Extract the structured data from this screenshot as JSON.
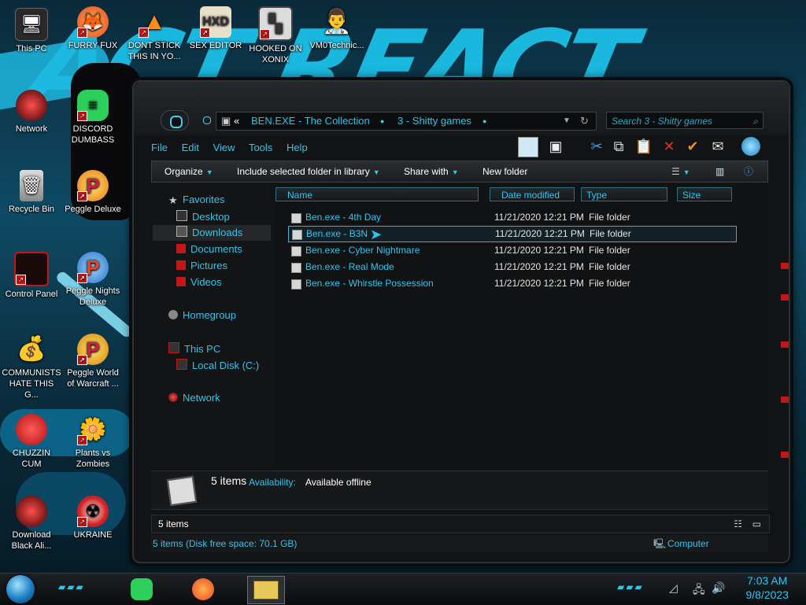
{
  "desktop": {
    "wallpaper_text": "ACT REACT",
    "icons": [
      {
        "id": "this-pc",
        "label": "This PC"
      },
      {
        "id": "furry-fux",
        "label": "FURRY FUX"
      },
      {
        "id": "dont-stick",
        "label": "DONT STICK THIS IN YO..."
      },
      {
        "id": "sex-editor",
        "label": "SEX EDITOR"
      },
      {
        "id": "hooked-on-xonix",
        "label": "HOOKED ON XONIX"
      },
      {
        "id": "vm0technic",
        "label": "VM0Technic..."
      },
      {
        "id": "network",
        "label": "Network"
      },
      {
        "id": "discord-dumbass",
        "label": "DISCORD DUMBASS"
      },
      {
        "id": "recycle-bin",
        "label": "Recycle Bin"
      },
      {
        "id": "peggle-deluxe",
        "label": "Peggle Deluxe"
      },
      {
        "id": "control-panel",
        "label": "Control Panel"
      },
      {
        "id": "peggle-nights",
        "label": "Peggle Nights Deluxe"
      },
      {
        "id": "communists",
        "label": "COMMUNISTS HATE THIS G..."
      },
      {
        "id": "peggle-world",
        "label": "Peggle World of Warcraft ..."
      },
      {
        "id": "chuzzin-cum",
        "label": "CHUZZIN CUM"
      },
      {
        "id": "plants-vs-zombies",
        "label": "Plants vs Zombies"
      },
      {
        "id": "download-black",
        "label": "Download Black Ali..."
      },
      {
        "id": "ukraine",
        "label": "UKRAINE"
      }
    ]
  },
  "explorer": {
    "breadcrumb": {
      "chevron": "«",
      "part1": "BEN.EXE - The Collection",
      "part2": "3 - Shitty games"
    },
    "search_placeholder": "Search 3 - Shitty games",
    "menu": [
      "File",
      "Edit",
      "View",
      "Tools",
      "Help"
    ],
    "commands": {
      "organize": "Organize",
      "include": "Include selected folder in library",
      "share": "Share with",
      "new_folder": "New folder"
    },
    "nav": {
      "favorites": "Favorites",
      "desktop": "Desktop",
      "downloads": "Downloads",
      "documents": "Documents",
      "pictures": "Pictures",
      "videos": "Videos",
      "homegroup": "Homegroup",
      "this_pc": "This PC",
      "local_disk": "Local Disk (C:)",
      "network": "Network"
    },
    "columns": {
      "name": "Name",
      "date": "Date modified",
      "type": "Type",
      "size": "Size"
    },
    "files": [
      {
        "name": "Ben.exe - 4th Day",
        "date": "11/21/2020 12:21 PM",
        "type": "File folder"
      },
      {
        "name": "Ben.exe - B3N",
        "date": "11/21/2020 12:21 PM",
        "type": "File folder"
      },
      {
        "name": "Ben.exe - Cyber Nightmare",
        "date": "11/21/2020 12:21 PM",
        "type": "File folder"
      },
      {
        "name": "Ben.exe - Real Mode",
        "date": "11/21/2020 12:21 PM",
        "type": "File folder"
      },
      {
        "name": "Ben.exe - Whirstle Possession",
        "date": "11/21/2020 12:21 PM",
        "type": "File folder"
      }
    ],
    "selected_index": 1,
    "details": {
      "count": "5 items",
      "availability_label": "Availability:",
      "availability_value": "Available offline"
    },
    "status_items": "5 items",
    "bottom": {
      "disk": "5 items (Disk free space: 70.1 GB)",
      "computer": "Computer"
    }
  },
  "taskbar": {
    "time": "7:03 AM",
    "date": "9/8/2023"
  },
  "colors": {
    "accent": "#2fc6ee",
    "window_bg": "#111315",
    "alert": "#c01818"
  }
}
